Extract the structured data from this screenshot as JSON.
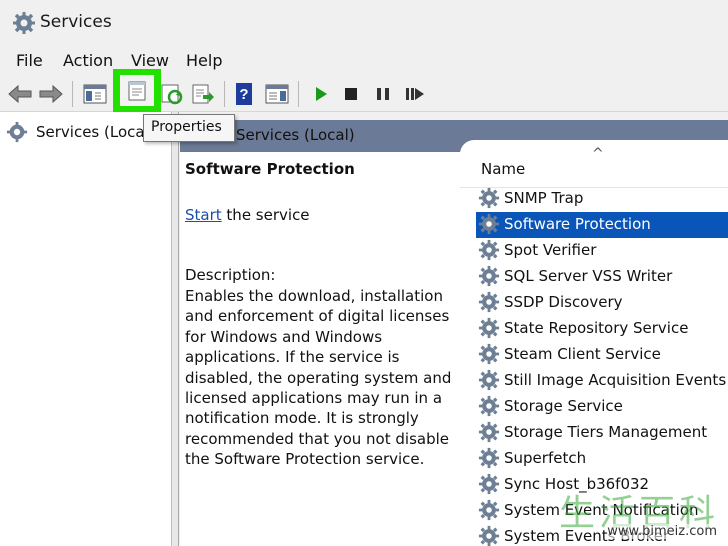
{
  "window": {
    "title": "Services"
  },
  "menu": [
    "File",
    "Action",
    "View",
    "Help"
  ],
  "toolbar": {
    "icons": [
      "back-arrow-icon",
      "forward-arrow-icon",
      "show-hide-console-tree-icon",
      "properties-icon",
      "refresh-icon",
      "export-list-icon",
      "help-icon",
      "show-action-pane-icon",
      "start-service-icon",
      "stop-service-icon",
      "pause-service-icon",
      "restart-service-icon"
    ],
    "highlighted": "properties-icon",
    "tooltip": "Properties",
    "colors": {
      "highlight": "#22e000",
      "play": "#1a9a1a",
      "help": "#1e3c9c"
    }
  },
  "tree": {
    "root_label": "Services (Local)"
  },
  "pane": {
    "header_label": "Services (Local)",
    "header_color": "#6b7a96"
  },
  "details": {
    "service_name": "Software Protection",
    "start_link": "Start",
    "start_suffix": " the service",
    "description_label": "Description:",
    "description": "Enables the download, installation and enforcement of digital licenses for Windows and Windows applications. If the service is disabled, the operating system and licensed applications may run in a notification mode. It is strongly recommended that you not disable the Software Protection service."
  },
  "list": {
    "sort_indicator": "^",
    "column_name": "Name",
    "selected_color": "#0a55b8",
    "rows": [
      {
        "name": "SNMP Trap",
        "selected": false
      },
      {
        "name": "Software Protection",
        "selected": true
      },
      {
        "name": "Spot Verifier",
        "selected": false
      },
      {
        "name": "SQL Server VSS Writer",
        "selected": false
      },
      {
        "name": "SSDP Discovery",
        "selected": false
      },
      {
        "name": "State Repository Service",
        "selected": false
      },
      {
        "name": "Steam Client Service",
        "selected": false
      },
      {
        "name": "Still Image Acquisition Events",
        "selected": false
      },
      {
        "name": "Storage Service",
        "selected": false
      },
      {
        "name": "Storage Tiers Management",
        "selected": false
      },
      {
        "name": "Superfetch",
        "selected": false
      },
      {
        "name": "Sync Host_b36f032",
        "selected": false
      },
      {
        "name": "System Event Notification",
        "selected": false
      },
      {
        "name": "System Events Broker",
        "selected": false
      }
    ]
  },
  "watermark": {
    "chars": "生活百科",
    "url": "www.bimeiz.com"
  }
}
